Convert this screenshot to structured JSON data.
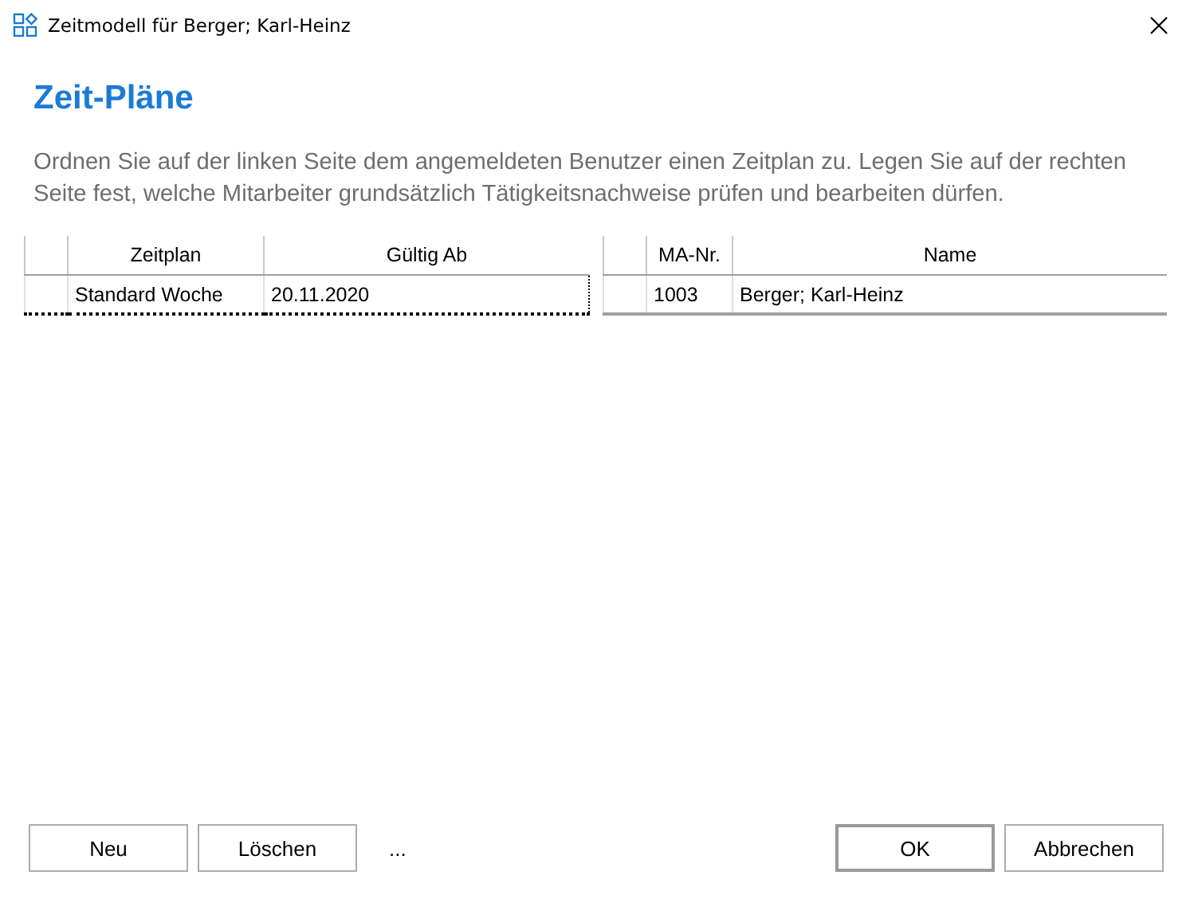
{
  "window": {
    "title": "Zeitmodell für Berger; Karl-Heinz"
  },
  "heading": "Zeit-Pläne",
  "description": "Ordnen Sie auf der linken Seite dem angemeldeten Benutzer einen Zeitplan zu. Legen Sie auf der rechten Seite fest, welche Mitarbeiter grundsätzlich Tätigkeitsnachweise prüfen und bearbeiten dürfen.",
  "schedule_table": {
    "columns": [
      "Zeitplan",
      "Gültig Ab"
    ],
    "rows": [
      {
        "cells": [
          "Standard Woche",
          "20.11.2020"
        ],
        "selected": true
      }
    ]
  },
  "employee_table": {
    "columns": [
      "MA-Nr.",
      "Name"
    ],
    "rows": [
      {
        "cells": [
          "1003",
          "Berger; Karl-Heinz"
        ],
        "selected": false
      }
    ]
  },
  "left_buttons": [
    {
      "label": "Neu",
      "default": false
    },
    {
      "label": "Löschen",
      "default": false
    }
  ],
  "ellipsis": "...",
  "right_buttons": [
    {
      "label": "OK",
      "default": true
    },
    {
      "label": "Abbrechen",
      "default": false
    }
  ]
}
